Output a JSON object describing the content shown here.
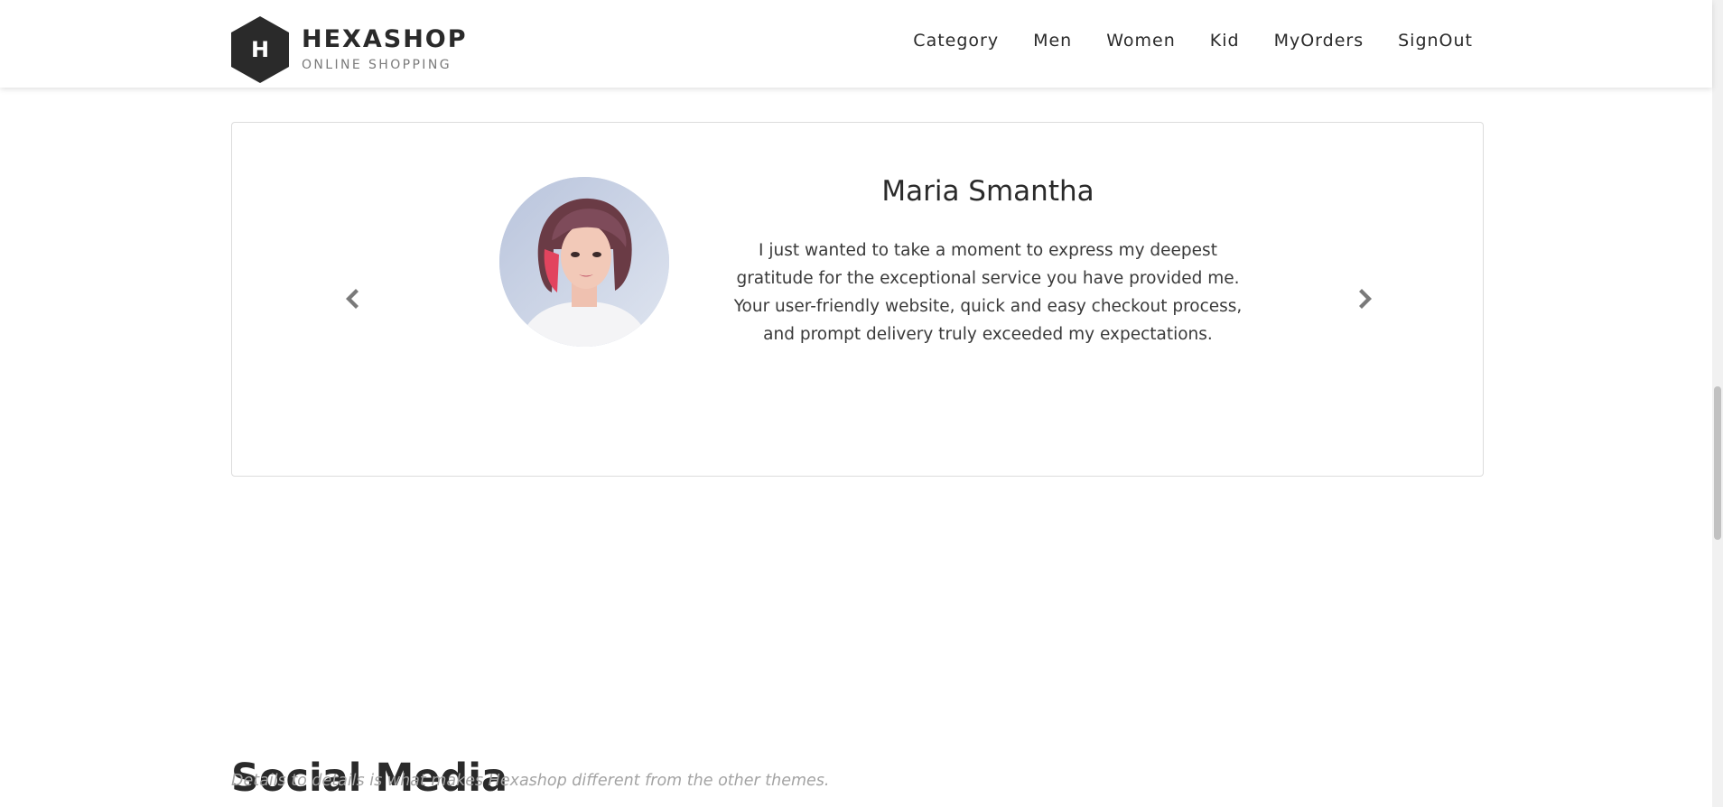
{
  "header": {
    "logo_letter": "H",
    "logo_name": "HEXASHOP",
    "logo_sub": "ONLINE SHOPPING",
    "nav": [
      {
        "label": "Category"
      },
      {
        "label": "Men"
      },
      {
        "label": "Women"
      },
      {
        "label": "Kid"
      },
      {
        "label": "MyOrders"
      },
      {
        "label": "SignOut"
      }
    ]
  },
  "testimonial": {
    "name": "Maria Smantha",
    "text": "I just wanted to take a moment to express my deepest gratitude for the exceptional service you have provided me. Your user-friendly website, quick and easy checkout process, and prompt delivery truly exceeded my expectations.",
    "prev_icon": "chevron-left-icon",
    "next_icon": "chevron-right-icon"
  },
  "social": {
    "title": "Social Media",
    "subtitle": "Details to details is what makes Hexashop different from the other themes."
  },
  "colors": {
    "text": "#2a2a2a",
    "muted": "#a3a3a3",
    "logo_bg": "#2a2a2a",
    "border": "#dcdcdc",
    "arrow": "#7a7a7a"
  }
}
